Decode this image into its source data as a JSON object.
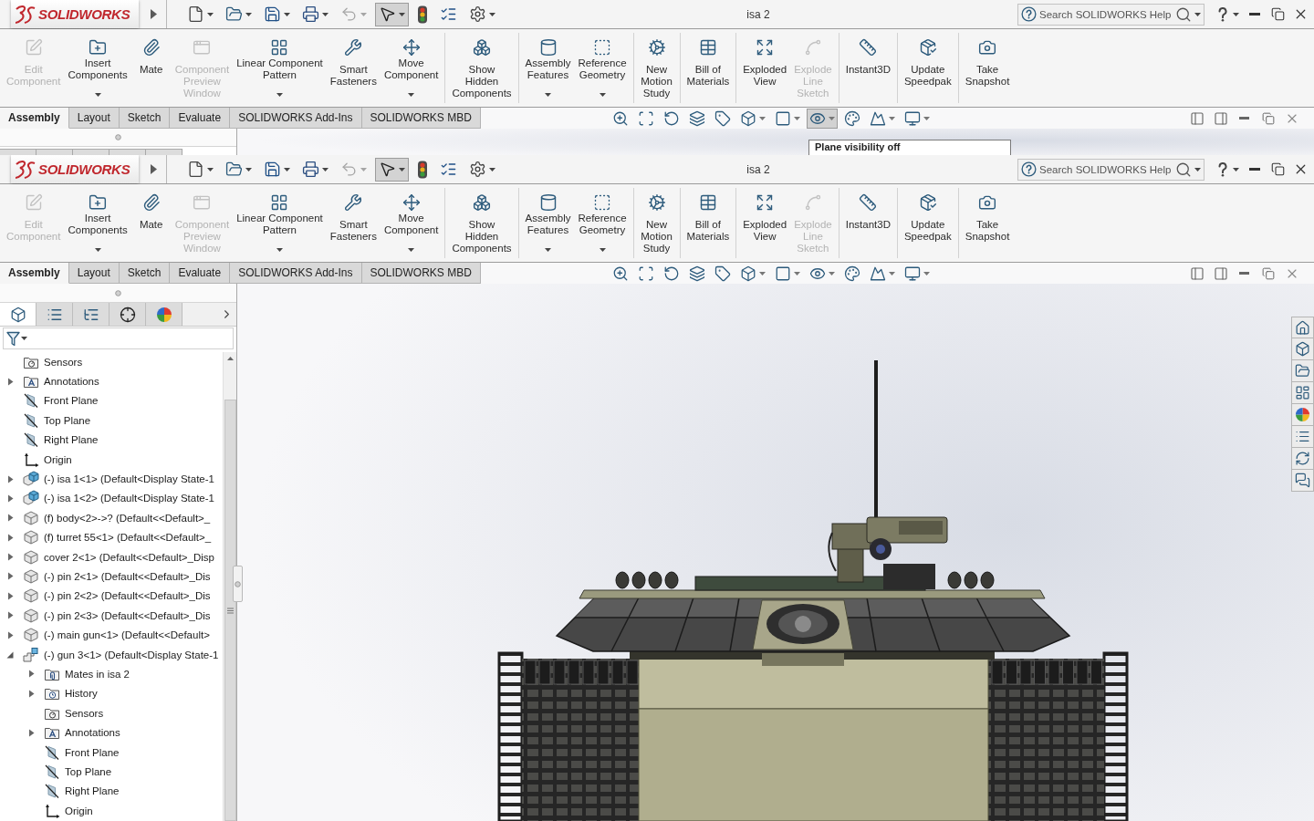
{
  "windows": [
    {
      "logo": "SOLIDWORKS",
      "quick_access": [
        {
          "dropdown": true,
          "disabled": false,
          "selected": false
        },
        {
          "dropdown": true,
          "disabled": false,
          "selected": false
        },
        {
          "dropdown": true,
          "disabled": false,
          "selected": false
        },
        {
          "dropdown": true,
          "disabled": false,
          "selected": false
        },
        {
          "dropdown": true,
          "disabled": true,
          "selected": false
        },
        {
          "dropdown": true,
          "disabled": false,
          "selected": true
        },
        {
          "dropdown": false,
          "disabled": false,
          "selected": false
        },
        {
          "dropdown": false,
          "disabled": false,
          "selected": false
        },
        {
          "dropdown": true,
          "disabled": false,
          "selected": false
        }
      ],
      "title": "isa 2",
      "help_search": {
        "placeholder": "Search SOLIDWORKS Help"
      },
      "ribbon": [
        {
          "items": [
            {
              "label": "Edit\nComponent",
              "disabled": true,
              "dropdown": false
            },
            {
              "label": "Insert\nComponents",
              "disabled": false,
              "dropdown": true
            },
            {
              "label": "Mate",
              "disabled": false,
              "dropdown": false
            },
            {
              "label": "Component\nPreview\nWindow",
              "disabled": true,
              "dropdown": false
            },
            {
              "label": "Linear Component\nPattern",
              "disabled": false,
              "dropdown": true
            },
            {
              "label": "Smart\nFasteners",
              "disabled": false,
              "dropdown": false
            },
            {
              "label": "Move\nComponent",
              "disabled": false,
              "dropdown": true
            }
          ]
        },
        {
          "items": [
            {
              "label": "Show\nHidden\nComponents",
              "disabled": false,
              "dropdown": false
            }
          ]
        },
        {
          "items": [
            {
              "label": "Assembly\nFeatures",
              "disabled": false,
              "dropdown": true
            },
            {
              "label": "Reference\nGeometry",
              "disabled": false,
              "dropdown": true
            }
          ]
        },
        {
          "items": [
            {
              "label": "New\nMotion\nStudy",
              "disabled": false,
              "dropdown": false
            }
          ]
        },
        {
          "items": [
            {
              "label": "Bill of\nMaterials",
              "disabled": false,
              "dropdown": false
            }
          ]
        },
        {
          "items": [
            {
              "label": "Exploded\nView",
              "disabled": false,
              "dropdown": false
            },
            {
              "label": "Explode\nLine\nSketch",
              "disabled": true,
              "dropdown": false
            }
          ]
        },
        {
          "items": [
            {
              "label": "Instant3D",
              "disabled": false,
              "dropdown": false
            }
          ]
        },
        {
          "items": [
            {
              "label": "Update\nSpeedpak",
              "disabled": false,
              "dropdown": false
            }
          ]
        },
        {
          "items": [
            {
              "label": "Take\nSnapshot",
              "disabled": false,
              "dropdown": false
            }
          ]
        }
      ],
      "tabs": [
        {
          "label": "Assembly",
          "selected": true
        },
        {
          "label": "Layout",
          "selected": false
        },
        {
          "label": "Sketch",
          "selected": false
        },
        {
          "label": "Evaluate",
          "selected": false
        },
        {
          "label": "SOLIDWORKS Add-Ins",
          "selected": false
        },
        {
          "label": "SOLIDWORKS MBD",
          "selected": false
        }
      ],
      "view_toolbar": [
        {
          "dropdown": false,
          "selected": false
        },
        {
          "dropdown": false,
          "selected": false
        },
        {
          "dropdown": false,
          "selected": false
        },
        {
          "dropdown": false,
          "selected": false
        },
        {
          "dropdown": false,
          "selected": false
        },
        {
          "dropdown": true,
          "selected": false
        },
        {
          "dropdown": true,
          "selected": false
        },
        {
          "dropdown": true,
          "selected": true
        },
        {
          "dropdown": false,
          "selected": false
        },
        {
          "dropdown": true,
          "selected": false
        },
        {
          "dropdown": true,
          "selected": false
        }
      ],
      "tooltip": "Plane visibility off"
    },
    {
      "logo": "SOLIDWORKS",
      "quick_access": [
        {
          "dropdown": true,
          "disabled": false,
          "selected": false
        },
        {
          "dropdown": true,
          "disabled": false,
          "selected": false
        },
        {
          "dropdown": true,
          "disabled": false,
          "selected": false
        },
        {
          "dropdown": true,
          "disabled": false,
          "selected": false
        },
        {
          "dropdown": true,
          "disabled": true,
          "selected": false
        },
        {
          "dropdown": true,
          "disabled": false,
          "selected": true
        },
        {
          "dropdown": false,
          "disabled": false,
          "selected": false
        },
        {
          "dropdown": false,
          "disabled": false,
          "selected": false
        },
        {
          "dropdown": true,
          "disabled": false,
          "selected": false
        }
      ],
      "title": "isa 2",
      "help_search": {
        "placeholder": "Search SOLIDWORKS Help"
      },
      "ribbon": [
        {
          "items": [
            {
              "label": "Edit\nComponent",
              "disabled": true,
              "dropdown": false
            },
            {
              "label": "Insert\nComponents",
              "disabled": false,
              "dropdown": true
            },
            {
              "label": "Mate",
              "disabled": false,
              "dropdown": false
            },
            {
              "label": "Component\nPreview\nWindow",
              "disabled": true,
              "dropdown": false
            },
            {
              "label": "Linear Component\nPattern",
              "disabled": false,
              "dropdown": true
            },
            {
              "label": "Smart\nFasteners",
              "disabled": false,
              "dropdown": false
            },
            {
              "label": "Move\nComponent",
              "disabled": false,
              "dropdown": true
            }
          ]
        },
        {
          "items": [
            {
              "label": "Show\nHidden\nComponents",
              "disabled": false,
              "dropdown": false
            }
          ]
        },
        {
          "items": [
            {
              "label": "Assembly\nFeatures",
              "disabled": false,
              "dropdown": true
            },
            {
              "label": "Reference\nGeometry",
              "disabled": false,
              "dropdown": true
            }
          ]
        },
        {
          "items": [
            {
              "label": "New\nMotion\nStudy",
              "disabled": false,
              "dropdown": false
            }
          ]
        },
        {
          "items": [
            {
              "label": "Bill of\nMaterials",
              "disabled": false,
              "dropdown": false
            }
          ]
        },
        {
          "items": [
            {
              "label": "Exploded\nView",
              "disabled": false,
              "dropdown": false
            },
            {
              "label": "Explode\nLine\nSketch",
              "disabled": true,
              "dropdown": false
            }
          ]
        },
        {
          "items": [
            {
              "label": "Instant3D",
              "disabled": false,
              "dropdown": false
            }
          ]
        },
        {
          "items": [
            {
              "label": "Update\nSpeedpak",
              "disabled": false,
              "dropdown": false
            }
          ]
        },
        {
          "items": [
            {
              "label": "Take\nSnapshot",
              "disabled": false,
              "dropdown": false
            }
          ]
        }
      ],
      "tabs": [
        {
          "label": "Assembly",
          "selected": true
        },
        {
          "label": "Layout",
          "selected": false
        },
        {
          "label": "Sketch",
          "selected": false
        },
        {
          "label": "Evaluate",
          "selected": false
        },
        {
          "label": "SOLIDWORKS Add-Ins",
          "selected": false
        },
        {
          "label": "SOLIDWORKS MBD",
          "selected": false
        }
      ],
      "view_toolbar": [
        {
          "dropdown": false,
          "selected": false
        },
        {
          "dropdown": false,
          "selected": false
        },
        {
          "dropdown": false,
          "selected": false
        },
        {
          "dropdown": false,
          "selected": false
        },
        {
          "dropdown": false,
          "selected": false
        },
        {
          "dropdown": true,
          "selected": false
        },
        {
          "dropdown": true,
          "selected": false
        },
        {
          "dropdown": true,
          "selected": false
        },
        {
          "dropdown": false,
          "selected": false
        },
        {
          "dropdown": true,
          "selected": false
        },
        {
          "dropdown": true,
          "selected": false
        }
      ],
      "panel": {
        "tabs": [
          {
            "selected": true
          },
          {
            "selected": false
          },
          {
            "selected": false
          },
          {
            "selected": false
          },
          {
            "selected": false
          }
        ],
        "tree": [
          {
            "label": "Sensors",
            "kind": "sensors"
          },
          {
            "label": "Annotations",
            "kind": "annotations",
            "expanded": false
          },
          {
            "label": "Front Plane",
            "kind": "plane"
          },
          {
            "label": "Top Plane",
            "kind": "plane"
          },
          {
            "label": "Right Plane",
            "kind": "plane"
          },
          {
            "label": "Origin",
            "kind": "origin"
          },
          {
            "label": "(-) isa 1<1> (Default<Display State-1",
            "kind": "assembly",
            "expanded": false
          },
          {
            "label": "(-) isa 1<2> (Default<Display State-1",
            "kind": "assembly",
            "expanded": false
          },
          {
            "label": "(f) body<2>->? (Default<<Default>_",
            "kind": "part",
            "expanded": false
          },
          {
            "label": "(f) turret 55<1> (Default<<Default>_",
            "kind": "part",
            "expanded": false
          },
          {
            "label": "cover 2<1> (Default<<Default>_Disp",
            "kind": "part",
            "expanded": false
          },
          {
            "label": "(-) pin 2<1> (Default<<Default>_Dis",
            "kind": "part",
            "expanded": false
          },
          {
            "label": "(-) pin 2<2> (Default<<Default>_Dis",
            "kind": "part",
            "expanded": false
          },
          {
            "label": "(-) pin 2<3> (Default<<Default>_Dis",
            "kind": "part",
            "expanded": false
          },
          {
            "label": "(-) main gun<1> (Default<<Default>",
            "kind": "part",
            "expanded": false
          },
          {
            "label": "(-) gun 3<1> (Default<Display State-1",
            "kind": "subassembly",
            "expanded": true,
            "children": [
              {
                "label": "Mates in isa 2",
                "kind": "mates",
                "expanded": false
              },
              {
                "label": "History",
                "kind": "history",
                "expanded": false
              },
              {
                "label": "Sensors",
                "kind": "sensors"
              },
              {
                "label": "Annotations",
                "kind": "annotations",
                "expanded": false
              },
              {
                "label": "Front Plane",
                "kind": "plane"
              },
              {
                "label": "Top Plane",
                "kind": "plane"
              },
              {
                "label": "Right Plane",
                "kind": "plane"
              },
              {
                "label": "Origin",
                "kind": "origin"
              }
            ]
          }
        ]
      }
    }
  ]
}
